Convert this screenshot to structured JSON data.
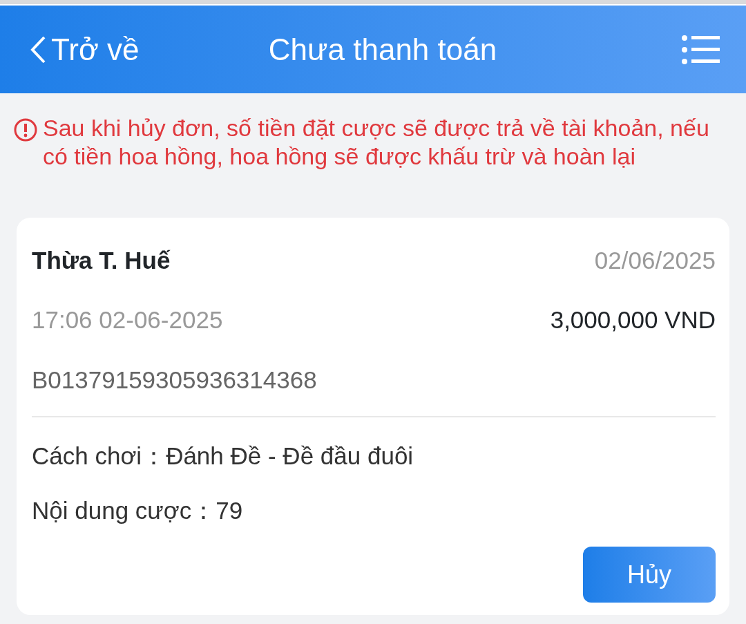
{
  "header": {
    "back": "Trở về",
    "title": "Chưa thanh toán"
  },
  "notice": "Sau khi hủy đơn, số tiền đặt cược sẽ được trả về tài khoản, nếu có tiền hoa hồng, hoa hồng sẽ được khấu trừ và hoàn lại",
  "order": {
    "region": "Thừa T. Huế",
    "date": "02/06/2025",
    "time": "17:06 02-06-2025",
    "amount": "3,000,000 VND",
    "code": "B01379159305936314368",
    "fields": [
      {
        "label": "Cách chơi：",
        "value": "Đánh Đề - Đề đầu đuôi"
      },
      {
        "label": "Nội dung cược：",
        "value": "79"
      }
    ],
    "button": "Hủy"
  }
}
